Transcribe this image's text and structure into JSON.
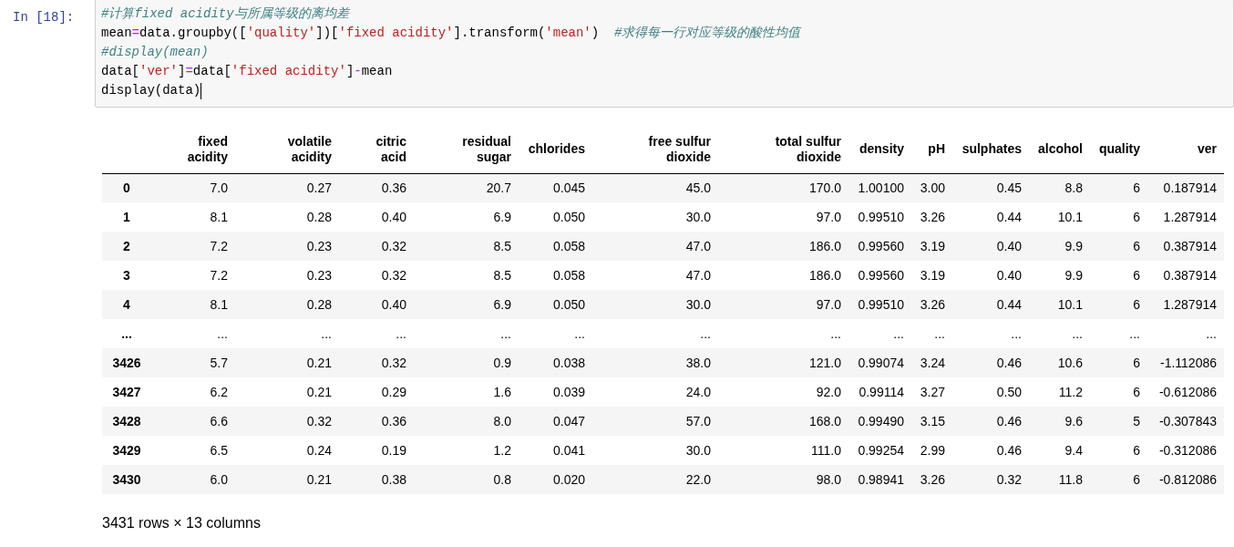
{
  "cell": {
    "prompt": "In [18]:",
    "code_lines": [
      [
        {
          "kind": "comment",
          "text": "#计算fixed acidity与所属等级的离均差"
        }
      ],
      [
        {
          "kind": "name",
          "text": "mean"
        },
        {
          "kind": "op",
          "text": "="
        },
        {
          "kind": "name",
          "text": "data.groupby(["
        },
        {
          "kind": "string",
          "text": "'quality'"
        },
        {
          "kind": "name",
          "text": "])["
        },
        {
          "kind": "string",
          "text": "'fixed acidity'"
        },
        {
          "kind": "name",
          "text": "].transform("
        },
        {
          "kind": "string",
          "text": "'mean'"
        },
        {
          "kind": "name",
          "text": ")  "
        },
        {
          "kind": "comment",
          "text": "#求得每一行对应等级的酸性均值"
        }
      ],
      [
        {
          "kind": "comment",
          "text": "#display(mean)"
        }
      ],
      [
        {
          "kind": "name",
          "text": "data["
        },
        {
          "kind": "string",
          "text": "'ver'"
        },
        {
          "kind": "name",
          "text": "]"
        },
        {
          "kind": "op",
          "text": "="
        },
        {
          "kind": "name",
          "text": "data["
        },
        {
          "kind": "string",
          "text": "'fixed acidity'"
        },
        {
          "kind": "name",
          "text": "]"
        },
        {
          "kind": "op",
          "text": "-"
        },
        {
          "kind": "name",
          "text": "mean"
        }
      ],
      [
        {
          "kind": "name",
          "text": "display(data)"
        }
      ]
    ],
    "cursor": true
  },
  "table": {
    "columns": [
      "fixed acidity",
      "volatile acidity",
      "citric acid",
      "residual sugar",
      "chlorides",
      "free sulfur dioxide",
      "total sulfur dioxide",
      "density",
      "pH",
      "sulphates",
      "alcohol",
      "quality",
      "ver"
    ],
    "rows": [
      {
        "index": "0",
        "cells": [
          "7.0",
          "0.27",
          "0.36",
          "20.7",
          "0.045",
          "45.0",
          "170.0",
          "1.00100",
          "3.00",
          "0.45",
          "8.8",
          "6",
          "0.187914"
        ]
      },
      {
        "index": "1",
        "cells": [
          "8.1",
          "0.28",
          "0.40",
          "6.9",
          "0.050",
          "30.0",
          "97.0",
          "0.99510",
          "3.26",
          "0.44",
          "10.1",
          "6",
          "1.287914"
        ]
      },
      {
        "index": "2",
        "cells": [
          "7.2",
          "0.23",
          "0.32",
          "8.5",
          "0.058",
          "47.0",
          "186.0",
          "0.99560",
          "3.19",
          "0.40",
          "9.9",
          "6",
          "0.387914"
        ]
      },
      {
        "index": "3",
        "cells": [
          "7.2",
          "0.23",
          "0.32",
          "8.5",
          "0.058",
          "47.0",
          "186.0",
          "0.99560",
          "3.19",
          "0.40",
          "9.9",
          "6",
          "0.387914"
        ]
      },
      {
        "index": "4",
        "cells": [
          "8.1",
          "0.28",
          "0.40",
          "6.9",
          "0.050",
          "30.0",
          "97.0",
          "0.99510",
          "3.26",
          "0.44",
          "10.1",
          "6",
          "1.287914"
        ]
      },
      {
        "index": "...",
        "cells": [
          "...",
          "...",
          "...",
          "...",
          "...",
          "...",
          "...",
          "...",
          "...",
          "...",
          "...",
          "...",
          "..."
        ]
      },
      {
        "index": "3426",
        "cells": [
          "5.7",
          "0.21",
          "0.32",
          "0.9",
          "0.038",
          "38.0",
          "121.0",
          "0.99074",
          "3.24",
          "0.46",
          "10.6",
          "6",
          "-1.112086"
        ]
      },
      {
        "index": "3427",
        "cells": [
          "6.2",
          "0.21",
          "0.29",
          "1.6",
          "0.039",
          "24.0",
          "92.0",
          "0.99114",
          "3.27",
          "0.50",
          "11.2",
          "6",
          "-0.612086"
        ]
      },
      {
        "index": "3428",
        "cells": [
          "6.6",
          "0.32",
          "0.36",
          "8.0",
          "0.047",
          "57.0",
          "168.0",
          "0.99490",
          "3.15",
          "0.46",
          "9.6",
          "5",
          "-0.307843"
        ]
      },
      {
        "index": "3429",
        "cells": [
          "6.5",
          "0.24",
          "0.19",
          "1.2",
          "0.041",
          "30.0",
          "111.0",
          "0.99254",
          "2.99",
          "0.46",
          "9.4",
          "6",
          "-0.312086"
        ]
      },
      {
        "index": "3430",
        "cells": [
          "6.0",
          "0.21",
          "0.38",
          "0.8",
          "0.020",
          "22.0",
          "98.0",
          "0.98941",
          "3.26",
          "0.32",
          "11.8",
          "6",
          "-0.812086"
        ]
      }
    ]
  },
  "summary": "3431 rows × 13 columns"
}
